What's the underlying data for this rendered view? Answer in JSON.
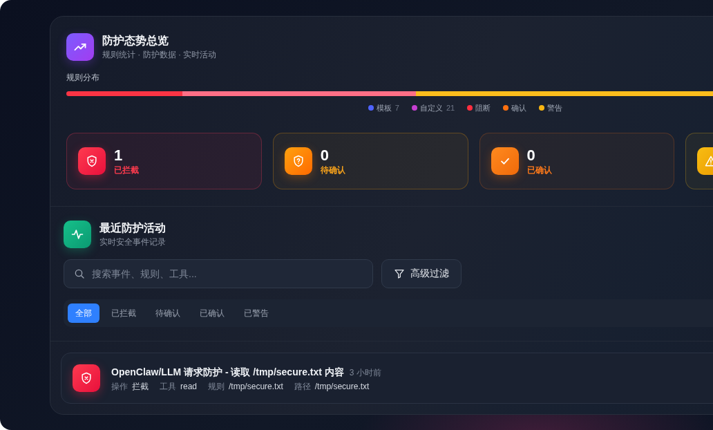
{
  "overview": {
    "title": "防护态势总览",
    "subtitle": "规则统计 · 防护数据 · 实时活动"
  },
  "rule_distribution": {
    "label": "规则分布",
    "segments": [
      {
        "level": 0.18,
        "color": "#fb3444"
      },
      {
        "level": 0.361,
        "color": "#ff6f86"
      },
      {
        "level": 0.459,
        "color": "#fcbd1c"
      }
    ],
    "legend": [
      {
        "label": "模板",
        "count": "7",
        "color": "#4f63ff"
      },
      {
        "label": "自定义",
        "count": "21",
        "color": "#c63fd1"
      },
      {
        "label": "阻断",
        "color": "#ff2e3f"
      },
      {
        "label": "确认",
        "color": "#ff700f"
      },
      {
        "label": "警告",
        "color": "#f8b512"
      }
    ]
  },
  "stats": [
    {
      "kind": "blocked",
      "value": "1",
      "label": "已拦截"
    },
    {
      "kind": "pending",
      "value": "0",
      "label": "待确认"
    },
    {
      "kind": "confirmed",
      "value": "0",
      "label": "已确认"
    },
    {
      "kind": "warning"
    }
  ],
  "activity": {
    "title": "最近防护活动",
    "subtitle": "实时安全事件记录",
    "search": {
      "placeholder": "搜索事件、规则、工具..."
    },
    "filter_button": "高级过滤",
    "tabs": [
      {
        "label": "全部",
        "selected": true
      },
      {
        "label": "已拦截",
        "selected": false
      },
      {
        "label": "待确认",
        "selected": false
      },
      {
        "label": "已确认",
        "selected": false
      },
      {
        "label": "已警告",
        "selected": false
      }
    ],
    "events": [
      {
        "kind": "blocked",
        "title": "OpenClaw/LLM 请求防护 - 读取 /tmp/secure.txt 内容",
        "time": "3 小时前",
        "fields": [
          {
            "label": "操作",
            "value": "拦截"
          },
          {
            "label": "工具",
            "value": "read"
          },
          {
            "label": "规则",
            "value": "/tmp/secure.txt"
          },
          {
            "label": "路径",
            "value": "/tmp/secure.txt"
          }
        ]
      }
    ]
  }
}
